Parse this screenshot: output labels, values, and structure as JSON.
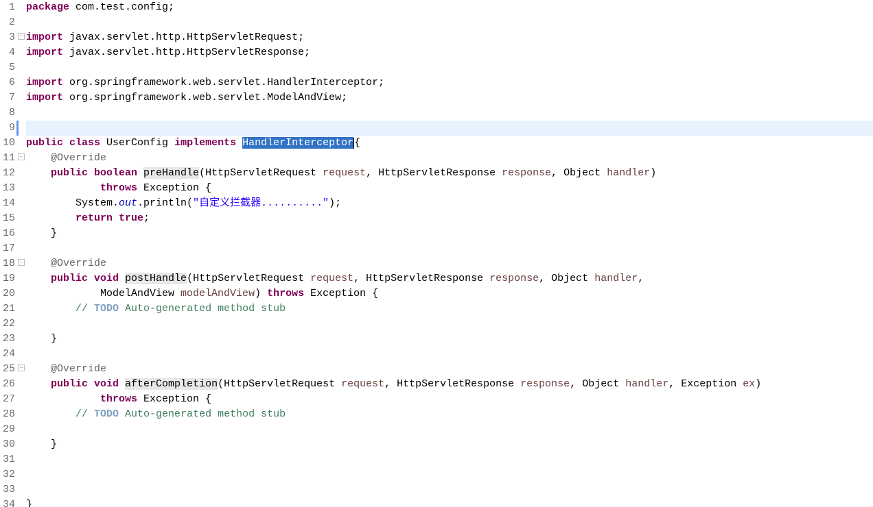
{
  "lines": [
    {
      "n": 1,
      "marker": "",
      "fragments": [
        {
          "t": "package ",
          "c": "kw"
        },
        {
          "t": "com.test.config;",
          "c": "plain"
        }
      ]
    },
    {
      "n": 2,
      "marker": "",
      "fragments": [
        {
          "t": " ",
          "c": "plain"
        }
      ]
    },
    {
      "n": 3,
      "marker": "fold",
      "fragments": [
        {
          "t": "import ",
          "c": "kw"
        },
        {
          "t": "javax.servlet.http.HttpServletRequest;",
          "c": "plain"
        }
      ]
    },
    {
      "n": 4,
      "marker": "",
      "fragments": [
        {
          "t": "import ",
          "c": "kw"
        },
        {
          "t": "javax.servlet.http.HttpServletResponse;",
          "c": "plain"
        }
      ]
    },
    {
      "n": 5,
      "marker": "",
      "fragments": [
        {
          "t": " ",
          "c": "plain"
        }
      ]
    },
    {
      "n": 6,
      "marker": "",
      "fragments": [
        {
          "t": "import ",
          "c": "kw"
        },
        {
          "t": "org.springframework.web.servlet.HandlerInterceptor;",
          "c": "plain"
        }
      ]
    },
    {
      "n": 7,
      "marker": "",
      "fragments": [
        {
          "t": "import ",
          "c": "kw"
        },
        {
          "t": "org.springframework.web.servlet.ModelAndView;",
          "c": "plain"
        }
      ]
    },
    {
      "n": 8,
      "marker": "",
      "fragments": [
        {
          "t": " ",
          "c": "plain"
        }
      ]
    },
    {
      "n": 9,
      "marker": "",
      "highlight": true,
      "bluebar": true,
      "fragments": [
        {
          "t": "public class ",
          "c": "kw"
        },
        {
          "t": "UserConfig ",
          "c": "plain"
        },
        {
          "t": "implements ",
          "c": "kw"
        },
        {
          "t": "HandlerInterceptor",
          "c": "selection"
        },
        {
          "t": "{",
          "c": "plain",
          "cursor": true
        }
      ]
    },
    {
      "n": 10,
      "marker": "",
      "fragments": [
        {
          "t": " ",
          "c": "plain"
        }
      ]
    },
    {
      "n": 11,
      "marker": "fold",
      "fragments": [
        {
          "t": "    ",
          "c": "plain"
        },
        {
          "t": "@Override",
          "c": "ann"
        }
      ]
    },
    {
      "n": 12,
      "marker": "",
      "fragments": [
        {
          "t": "    ",
          "c": "plain"
        },
        {
          "t": "public boolean ",
          "c": "kw"
        },
        {
          "t": "preHandle",
          "c": "plain",
          "bg": "method-decl-bg"
        },
        {
          "t": "(HttpServletRequest ",
          "c": "plain"
        },
        {
          "t": "request",
          "c": "param"
        },
        {
          "t": ", HttpServletResponse ",
          "c": "plain"
        },
        {
          "t": "response",
          "c": "param"
        },
        {
          "t": ", Object ",
          "c": "plain"
        },
        {
          "t": "handler",
          "c": "param"
        },
        {
          "t": ")",
          "c": "plain"
        }
      ]
    },
    {
      "n": 13,
      "marker": "",
      "fragments": [
        {
          "t": "            ",
          "c": "plain"
        },
        {
          "t": "throws ",
          "c": "kw"
        },
        {
          "t": "Exception {",
          "c": "plain"
        }
      ]
    },
    {
      "n": 14,
      "marker": "",
      "fragments": [
        {
          "t": "        System.",
          "c": "plain"
        },
        {
          "t": "out",
          "c": "field-static"
        },
        {
          "t": ".println(",
          "c": "plain"
        },
        {
          "t": "\"自定义拦截器..........\"",
          "c": "str"
        },
        {
          "t": ");",
          "c": "plain"
        }
      ]
    },
    {
      "n": 15,
      "marker": "",
      "fragments": [
        {
          "t": "        ",
          "c": "plain"
        },
        {
          "t": "return true",
          "c": "kw"
        },
        {
          "t": ";",
          "c": "plain"
        }
      ]
    },
    {
      "n": 16,
      "marker": "",
      "fragments": [
        {
          "t": "    }",
          "c": "plain"
        }
      ]
    },
    {
      "n": 17,
      "marker": "",
      "fragments": [
        {
          "t": " ",
          "c": "plain"
        }
      ]
    },
    {
      "n": 18,
      "marker": "fold",
      "fragments": [
        {
          "t": "    ",
          "c": "plain"
        },
        {
          "t": "@Override",
          "c": "ann"
        }
      ]
    },
    {
      "n": 19,
      "marker": "",
      "fragments": [
        {
          "t": "    ",
          "c": "plain"
        },
        {
          "t": "public void ",
          "c": "kw"
        },
        {
          "t": "postHandle",
          "c": "plain",
          "bg": "method-decl-bg"
        },
        {
          "t": "(HttpServletRequest ",
          "c": "plain"
        },
        {
          "t": "request",
          "c": "param"
        },
        {
          "t": ", HttpServletResponse ",
          "c": "plain"
        },
        {
          "t": "response",
          "c": "param"
        },
        {
          "t": ", Object ",
          "c": "plain"
        },
        {
          "t": "handler",
          "c": "param"
        },
        {
          "t": ",",
          "c": "plain"
        }
      ]
    },
    {
      "n": 20,
      "marker": "",
      "fragments": [
        {
          "t": "            ModelAndView ",
          "c": "plain"
        },
        {
          "t": "modelAndView",
          "c": "param"
        },
        {
          "t": ") ",
          "c": "plain"
        },
        {
          "t": "throws ",
          "c": "kw"
        },
        {
          "t": "Exception {",
          "c": "plain"
        }
      ]
    },
    {
      "n": 21,
      "marker": "",
      "fragments": [
        {
          "t": "        ",
          "c": "plain"
        },
        {
          "t": "// ",
          "c": "comment"
        },
        {
          "t": "TODO",
          "c": "todo"
        },
        {
          "t": " Auto-generated method stub",
          "c": "comment"
        }
      ]
    },
    {
      "n": 22,
      "marker": "",
      "fragments": [
        {
          "t": " ",
          "c": "plain"
        }
      ]
    },
    {
      "n": 23,
      "marker": "",
      "fragments": [
        {
          "t": "    }",
          "c": "plain"
        }
      ]
    },
    {
      "n": 24,
      "marker": "",
      "fragments": [
        {
          "t": " ",
          "c": "plain"
        }
      ]
    },
    {
      "n": 25,
      "marker": "fold",
      "fragments": [
        {
          "t": "    ",
          "c": "plain"
        },
        {
          "t": "@Override",
          "c": "ann"
        }
      ]
    },
    {
      "n": 26,
      "marker": "",
      "fragments": [
        {
          "t": "    ",
          "c": "plain"
        },
        {
          "t": "public void ",
          "c": "kw"
        },
        {
          "t": "afterCompletion",
          "c": "plain",
          "bg": "method-decl-bg"
        },
        {
          "t": "(HttpServletRequest ",
          "c": "plain"
        },
        {
          "t": "request",
          "c": "param"
        },
        {
          "t": ", HttpServletResponse ",
          "c": "plain"
        },
        {
          "t": "response",
          "c": "param"
        },
        {
          "t": ", Object ",
          "c": "plain"
        },
        {
          "t": "handler",
          "c": "param"
        },
        {
          "t": ", Exception ",
          "c": "plain"
        },
        {
          "t": "ex",
          "c": "param"
        },
        {
          "t": ")",
          "c": "plain"
        }
      ]
    },
    {
      "n": 27,
      "marker": "",
      "fragments": [
        {
          "t": "            ",
          "c": "plain"
        },
        {
          "t": "throws ",
          "c": "kw"
        },
        {
          "t": "Exception {",
          "c": "plain"
        }
      ]
    },
    {
      "n": 28,
      "marker": "",
      "fragments": [
        {
          "t": "        ",
          "c": "plain"
        },
        {
          "t": "// ",
          "c": "comment"
        },
        {
          "t": "TODO",
          "c": "todo"
        },
        {
          "t": " Auto-generated method stub",
          "c": "comment"
        }
      ]
    },
    {
      "n": 29,
      "marker": "",
      "fragments": [
        {
          "t": " ",
          "c": "plain"
        }
      ]
    },
    {
      "n": 30,
      "marker": "",
      "fragments": [
        {
          "t": "    }",
          "c": "plain"
        }
      ]
    },
    {
      "n": 31,
      "marker": "",
      "fragments": [
        {
          "t": " ",
          "c": "plain"
        }
      ]
    },
    {
      "n": 32,
      "marker": "",
      "fragments": [
        {
          "t": " ",
          "c": "plain"
        }
      ]
    },
    {
      "n": 33,
      "marker": "",
      "fragments": [
        {
          "t": " ",
          "c": "plain"
        }
      ]
    },
    {
      "n": 34,
      "marker": "",
      "fragments": [
        {
          "t": "}",
          "c": "plain"
        }
      ]
    }
  ]
}
